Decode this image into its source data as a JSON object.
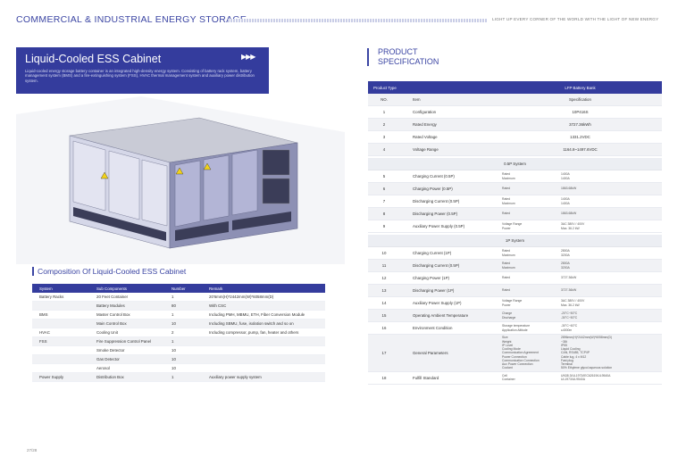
{
  "header": {
    "title": "COMMERCIAL & INDUSTRIAL ENERGY STORAGE",
    "tagline": "LIGHT UP EVERY CORNER OF THE WORLD WITH THE LIGHT OF NEW ENERGY"
  },
  "banner": {
    "title": "Liquid-Cooled ESS Cabinet",
    "arrows": "▶▶▶",
    "description": "Liquid-cooled energy storage battery container is an integrated high-density energy system. Consisting of battery rack system, battery management system (BMS) and a fire-extinguishing system (FSS), HVAC thermal management system and auxiliary power distribution system."
  },
  "composition": {
    "title": "Composition Of Liquid-Cooled ESS Cabinet",
    "columns": [
      "System",
      "Sub Components",
      "Number",
      "Remark"
    ],
    "rows": [
      {
        "system": "Battery Racks",
        "sub": "20 Feet Container",
        "number": "1",
        "remark": "20'6mm(H)*2442mm(W)*6058mm(D)"
      },
      {
        "system": "",
        "sub": "Battery Modules",
        "number": "80",
        "remark": "With CSC"
      },
      {
        "system": "BMS",
        "sub": "Master Control Box",
        "number": "1",
        "remark": "Including PMH, MBMU, ETH, Fiber Conversion Module"
      },
      {
        "system": "",
        "sub": "Main Control Box",
        "number": "10",
        "remark": "Including SBMU, fuse, isolation switch and so on"
      },
      {
        "system": "HVAC",
        "sub": "Cooling Unit",
        "number": "2",
        "remark": "Including compressor, pump, fan, heater and others"
      },
      {
        "system": "FSS",
        "sub": "Fire Suppression Control Panel",
        "number": "1",
        "remark": ""
      },
      {
        "system": "",
        "sub": "Smoke Detector",
        "number": "10",
        "remark": ""
      },
      {
        "system": "",
        "sub": "Gas Detector",
        "number": "10",
        "remark": ""
      },
      {
        "system": "",
        "sub": "Aerosol",
        "number": "10",
        "remark": ""
      },
      {
        "system": "Power Supply",
        "sub": "Distribution Box",
        "number": "1",
        "remark": "Auxiliary power supply system"
      }
    ]
  },
  "spec": {
    "title_line1": "PRODUCT",
    "title_line2": "SPECIFICATION",
    "head": {
      "left": "Product Type",
      "right": "LFP Battery Bank"
    },
    "col_head": {
      "no": "NO.",
      "item": "Item",
      "spec": "Specification"
    },
    "basic": [
      {
        "no": "1",
        "item": "Configuration",
        "value": "10P416S"
      },
      {
        "no": "2",
        "item": "Rated Energy",
        "value": "3727.36kWh"
      },
      {
        "no": "3",
        "item": "Rated Voltage",
        "value": "1331.2VDC"
      },
      {
        "no": "4",
        "item": "Voltage Range",
        "value": "1164.8~1497.6VDC"
      }
    ],
    "section_05p": "0.5P System",
    "rows_05p": [
      {
        "no": "5",
        "item": "Charging Current (0.5P)",
        "sub": [
          [
            "Rated",
            "1400A"
          ],
          [
            "Maximum",
            "1400A"
          ]
        ]
      },
      {
        "no": "6",
        "item": "Charging Power (0.5P)",
        "sub": [
          [
            "Rated",
            "1863.68kW"
          ]
        ]
      },
      {
        "no": "7",
        "item": "Discharging Current (0.5P)",
        "sub": [
          [
            "Rated",
            "1400A"
          ],
          [
            "Maximum",
            "1400A"
          ]
        ]
      },
      {
        "no": "8",
        "item": "Discharging Power (0.5P)",
        "sub": [
          [
            "Rated",
            "1863.68kW"
          ]
        ]
      },
      {
        "no": "9",
        "item": "Auxiliary Power Supply (0.5P)",
        "sub": [
          [
            "Voltage Range",
            "3AC 380V / 400V"
          ],
          [
            "Power",
            "Max. 36.2 kW"
          ]
        ]
      }
    ],
    "section_1p": "1P System",
    "rows_1p": [
      {
        "no": "10",
        "item": "Charging Current (1P)",
        "sub": [
          [
            "Rated",
            "2800A"
          ],
          [
            "Maximum",
            "3200A"
          ]
        ]
      },
      {
        "no": "11",
        "item": "Discharging Current (0.5P)",
        "sub": [
          [
            "Rated",
            "2800A"
          ],
          [
            "Maximum",
            "3200A"
          ]
        ]
      },
      {
        "no": "12",
        "item": "Charging Power (1P)",
        "sub": [
          [
            "Rated",
            "3727.36kW"
          ]
        ]
      },
      {
        "no": "13",
        "item": "Discharging Power (1P)",
        "sub": [
          [
            "Rated",
            "3727.36kW"
          ]
        ]
      },
      {
        "no": "14",
        "item": "Auxiliary Power Supply (1P)",
        "sub": [
          [
            "Voltage Range",
            "3AC 380V / 400V"
          ],
          [
            "Power",
            "Max. 36.2 kW"
          ]
        ]
      },
      {
        "no": "15",
        "item": "Operating Ambient Temperature",
        "sub": [
          [
            "Charge",
            "-20°C~50°C"
          ],
          [
            "Discharge",
            "-30°C~50°C"
          ]
        ]
      },
      {
        "no": "16",
        "item": "Environment Condition",
        "sub": [
          [
            "Storage temperature",
            "-30°C~60°C"
          ],
          [
            "Application Altitude",
            "≤4000m"
          ]
        ]
      },
      {
        "no": "17",
        "item": "General Parameters",
        "sub": [
          [
            "Size",
            "2896mm(H)*2442mm(W)*6058mm(D)"
          ],
          [
            "Weight",
            "~38t"
          ],
          [
            "IP Level",
            "IP55"
          ],
          [
            "Cooling Mode",
            "Liquid Cooling"
          ],
          [
            "Communication Agreement",
            "CAN, RS485, TCP/IP"
          ],
          [
            "Power Connection",
            "Cable lug, 4 x M12"
          ],
          [
            "Communication Connection",
            "Fast plug"
          ],
          [
            "Aux Power Connection",
            "Terminal"
          ],
          [
            "Coolant",
            "50% Ethylene glycol aqueous solution"
          ]
        ]
      },
      {
        "no": "18",
        "item": "Fulfill Standard",
        "sub": [
          [
            "Cell",
            "UN38.3/UL1973/IEC62619/UL9540A"
          ],
          [
            "Container",
            "UL1973/UL9540A"
          ]
        ]
      }
    ]
  },
  "page_number": "27/28",
  "colors": {
    "accent": "#343c9d",
    "title": "#3b45a3"
  }
}
